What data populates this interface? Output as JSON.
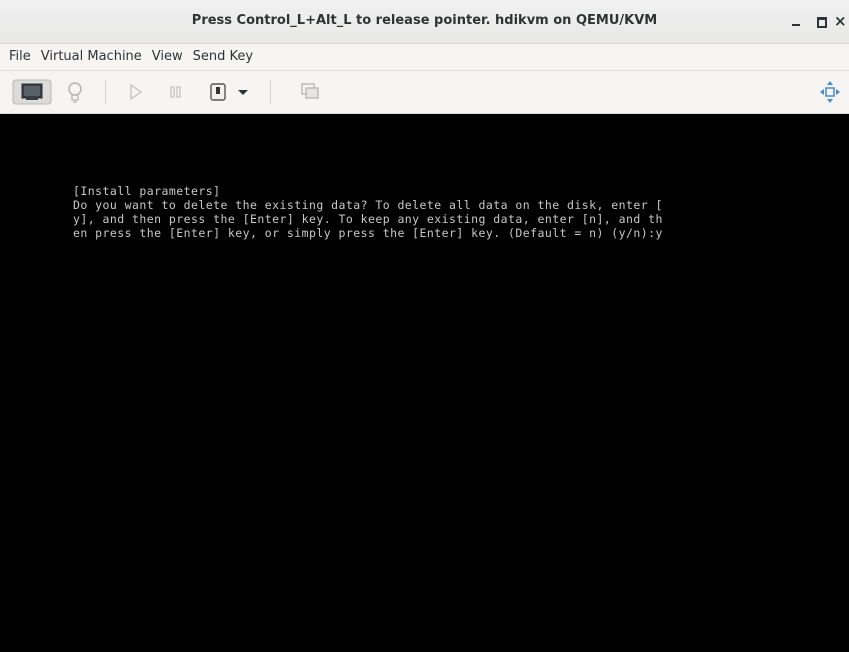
{
  "window": {
    "title": "Press Control_L+Alt_L to release pointer. hdikvm on QEMU/KVM",
    "controls": {
      "minimize": "_",
      "maximize": "□",
      "close": "×"
    }
  },
  "menubar": {
    "items": [
      "File",
      "Virtual Machine",
      "View",
      "Send Key"
    ]
  },
  "toolbar": {
    "buttons": [
      {
        "icon": "monitor-icon",
        "active": true
      },
      {
        "icon": "lightbulb-icon",
        "active": false
      },
      {
        "icon": "play-icon",
        "active": false
      },
      {
        "icon": "pause-icon",
        "active": false
      },
      {
        "icon": "power-icon",
        "active": true
      },
      {
        "icon": "dropdown-arrow-icon",
        "active": true
      },
      {
        "icon": "snapshot-icon",
        "active": false
      },
      {
        "icon": "fullscreen-icon",
        "active": true
      }
    ]
  },
  "console": {
    "lines": [
      "[Install parameters]",
      "Do you want to delete the existing data? To delete all data on the disk, enter [",
      "y], and then press the [Enter] key. To keep any existing data, enter [n], and th",
      "en press the [Enter] key, or simply press the [Enter] key. (Default = n) (y/n):y"
    ]
  },
  "colors": {
    "console_bg": "#000000",
    "console_fg": "#c8c8c8",
    "chrome_bg": "#f6f5f4"
  }
}
